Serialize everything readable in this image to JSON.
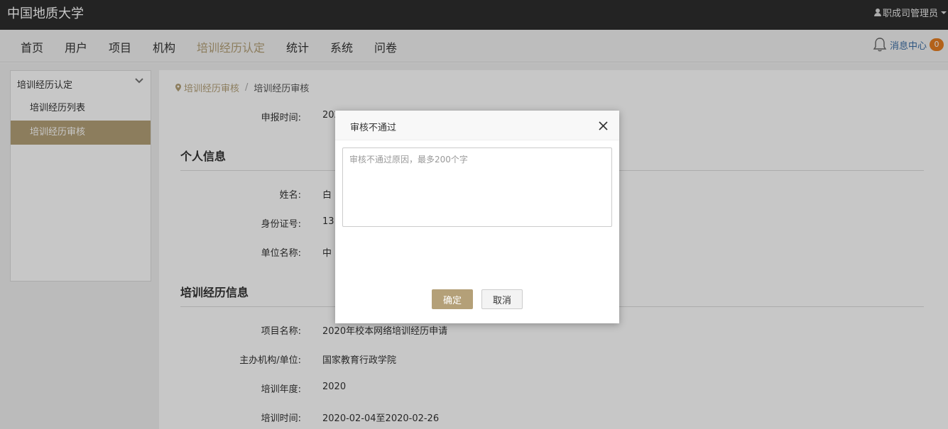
{
  "app": {
    "title": "中国地质大学",
    "user": "职成司管理员"
  },
  "nav": {
    "items": [
      {
        "label": "首页",
        "active": false
      },
      {
        "label": "用户",
        "active": false
      },
      {
        "label": "项目",
        "active": false
      },
      {
        "label": "机构",
        "active": false
      },
      {
        "label": "培训经历认定",
        "active": true
      },
      {
        "label": "统计",
        "active": false
      },
      {
        "label": "系统",
        "active": false
      },
      {
        "label": "问卷",
        "active": false
      }
    ],
    "messages": {
      "label": "消息中心",
      "count": "0"
    }
  },
  "sidebar": {
    "header": "培训经历认定",
    "items": [
      {
        "label": "培训经历列表",
        "active": false
      },
      {
        "label": "培训经历审核",
        "active": true
      }
    ]
  },
  "breadcrumb": {
    "parent": "培训经历审核",
    "separator": "/",
    "current": "培训经历审核"
  },
  "form": {
    "report_time": {
      "label": "申报时间:",
      "value": "202"
    },
    "personal_section": "个人信息",
    "personal": [
      {
        "label": "姓名:",
        "value": "白"
      },
      {
        "label": "身份证号:",
        "value": "13"
      },
      {
        "label": "单位名称:",
        "value": "中"
      }
    ],
    "training_section": "培训经历信息",
    "training": [
      {
        "label": "项目名称:",
        "value": "2020年校本网络培训经历申请"
      },
      {
        "label": "主办机构/单位:",
        "value": "国家教育行政学院"
      },
      {
        "label": "培训年度:",
        "value": "2020"
      },
      {
        "label": "培训时间:",
        "value": "2020-02-04至2020-02-26"
      }
    ]
  },
  "modal": {
    "title": "审核不通过",
    "reason_placeholder": "审核不通过原因，最多200个字",
    "reason_value": "",
    "confirm_label": "确定",
    "cancel_label": "取消"
  },
  "colors": {
    "accent": "#b4a078",
    "topbar": "#2e2e2e",
    "badge": "#e67e22",
    "link": "#3b6ea5"
  }
}
